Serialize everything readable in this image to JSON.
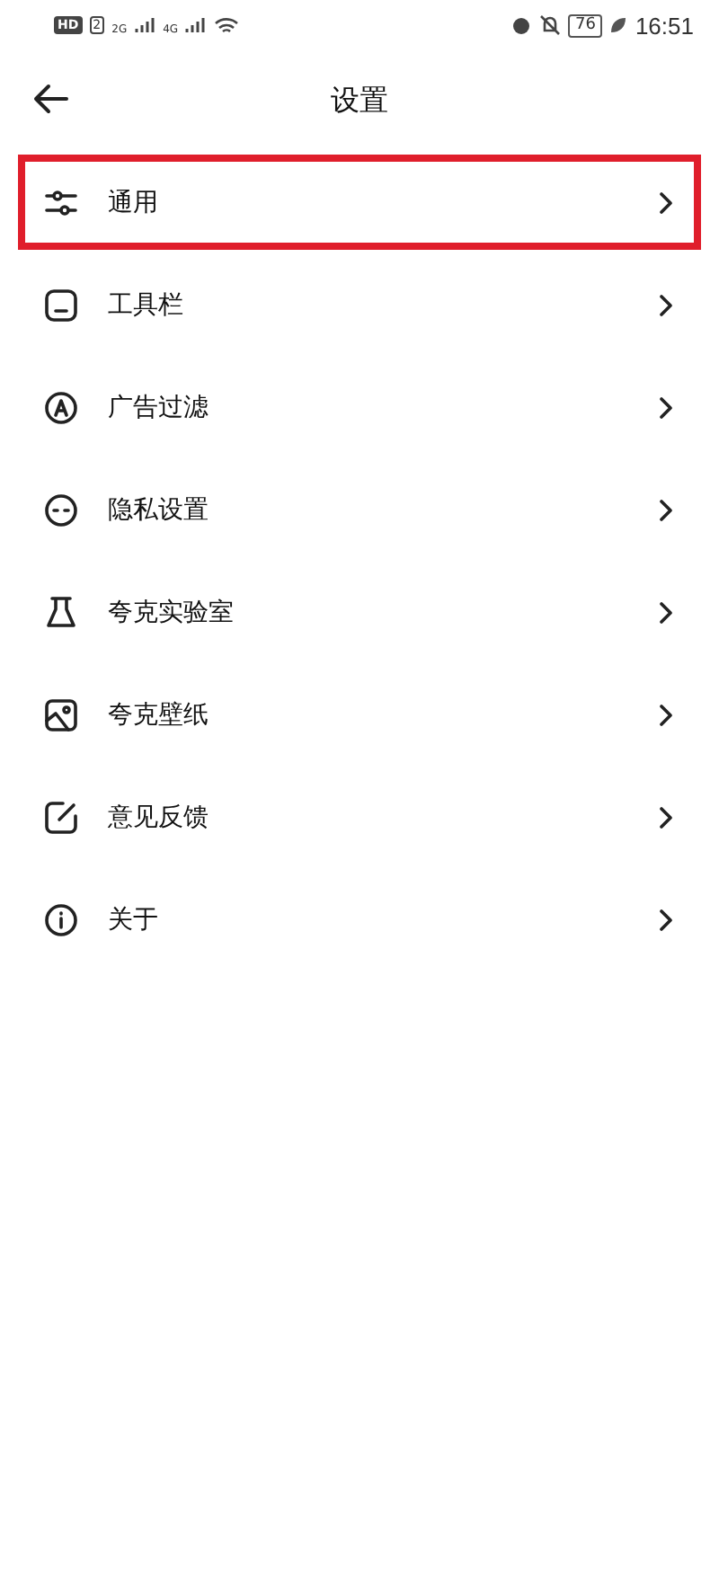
{
  "status_bar": {
    "hd": "HD",
    "sim": "2",
    "signal_1": "2G",
    "signal_2": "4G",
    "battery": "76",
    "time": "16:51"
  },
  "header": {
    "title": "设置"
  },
  "items": [
    {
      "kind": "sliders",
      "label": "通用",
      "highlighted": true
    },
    {
      "kind": "toolbar",
      "label": "工具栏",
      "highlighted": false
    },
    {
      "kind": "adblock",
      "label": "广告过滤",
      "highlighted": false
    },
    {
      "kind": "privacy",
      "label": "隐私设置",
      "highlighted": false
    },
    {
      "kind": "flask",
      "label": "夸克实验室",
      "highlighted": false
    },
    {
      "kind": "image",
      "label": "夸克壁纸",
      "highlighted": false
    },
    {
      "kind": "edit",
      "label": "意见反馈",
      "highlighted": false
    },
    {
      "kind": "info",
      "label": "关于",
      "highlighted": false
    }
  ]
}
